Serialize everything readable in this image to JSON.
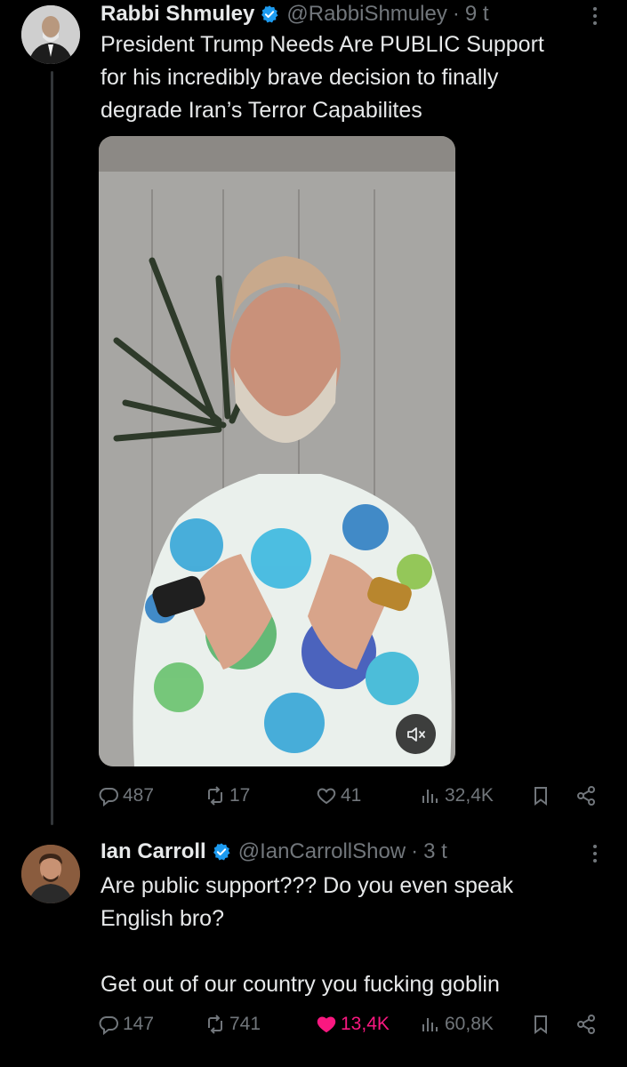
{
  "tweets": [
    {
      "author_name": "Rabbi Shmuley",
      "handle": "@RabbiShmuley",
      "separator": "·",
      "time": "9 t",
      "text": "President Trump Needs Are PUBLIC Support\nfor his incredibly brave decision to finally\ndegrade Iran’s Terror Capabilites",
      "replies": "487",
      "reposts": "17",
      "likes": "41",
      "views": "32,4K",
      "liked": false
    },
    {
      "author_name": "Ian Carroll",
      "handle": "@IanCarrollShow",
      "separator": "·",
      "time": "3 t",
      "text": "Are public support??? Do you even speak\nEnglish bro?\n\nGet out of our country you fucking goblin",
      "replies": "147",
      "reposts": "741",
      "likes": "13,4K",
      "views": "60,8K",
      "liked": true
    }
  ],
  "icons": {
    "verified": "verified-badge-icon",
    "more": "more-vertical-icon",
    "reply": "reply-icon",
    "repost": "repost-icon",
    "like": "heart-icon",
    "views": "views-bar-chart-icon",
    "bookmark": "bookmark-icon",
    "share": "share-icon",
    "mute": "muted-speaker-icon"
  },
  "colors": {
    "background": "#000000",
    "text": "#e7e9ea",
    "muted": "#71767b",
    "verified": "#1d9bf0",
    "like_active": "#f91880"
  }
}
